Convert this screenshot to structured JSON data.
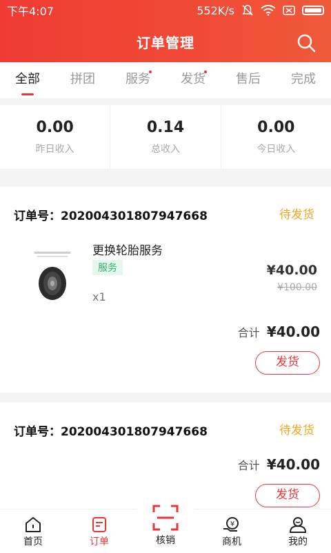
{
  "status_bar": {
    "time": "下午4:07",
    "speed": "552K/s"
  },
  "header": {
    "title": "订单管理"
  },
  "tabs": [
    {
      "label": "全部",
      "active": true,
      "dot": false
    },
    {
      "label": "拼团",
      "active": false,
      "dot": false
    },
    {
      "label": "服务",
      "active": false,
      "dot": true
    },
    {
      "label": "发货",
      "active": false,
      "dot": true
    },
    {
      "label": "售后",
      "active": false,
      "dot": false
    },
    {
      "label": "完成",
      "active": false,
      "dot": false
    }
  ],
  "stats": [
    {
      "value": "0.00",
      "label": "昨日收入"
    },
    {
      "value": "0.14",
      "label": "总收入"
    },
    {
      "value": "0.00",
      "label": "今日收入"
    }
  ],
  "orders": [
    {
      "order_no": "订单号：202004301807947668",
      "status": "待发货",
      "product_name": "更换轮胎服务",
      "tag": "服务",
      "qty": "x1",
      "price": "¥40.00",
      "orig_price": "¥100.00",
      "total_label": "合计",
      "total": "¥40.00",
      "button": "发货"
    },
    {
      "order_no": "订单号：202004301807947668",
      "status": "待发货",
      "total_label": "合计",
      "total": "¥40.00",
      "button": "发货"
    }
  ],
  "bottom_nav": [
    {
      "label": "首页",
      "icon": "home-icon",
      "active": false
    },
    {
      "label": "订单",
      "icon": "order-icon",
      "active": true
    },
    {
      "label": "核销",
      "icon": "scan-icon",
      "active": false
    },
    {
      "label": "商机",
      "icon": "business-icon",
      "active": false
    },
    {
      "label": "我的",
      "icon": "profile-icon",
      "active": false
    }
  ],
  "colors": {
    "primary": "#e9353a",
    "status_pending": "#f5a623",
    "tag_green": "#2fb56b"
  }
}
